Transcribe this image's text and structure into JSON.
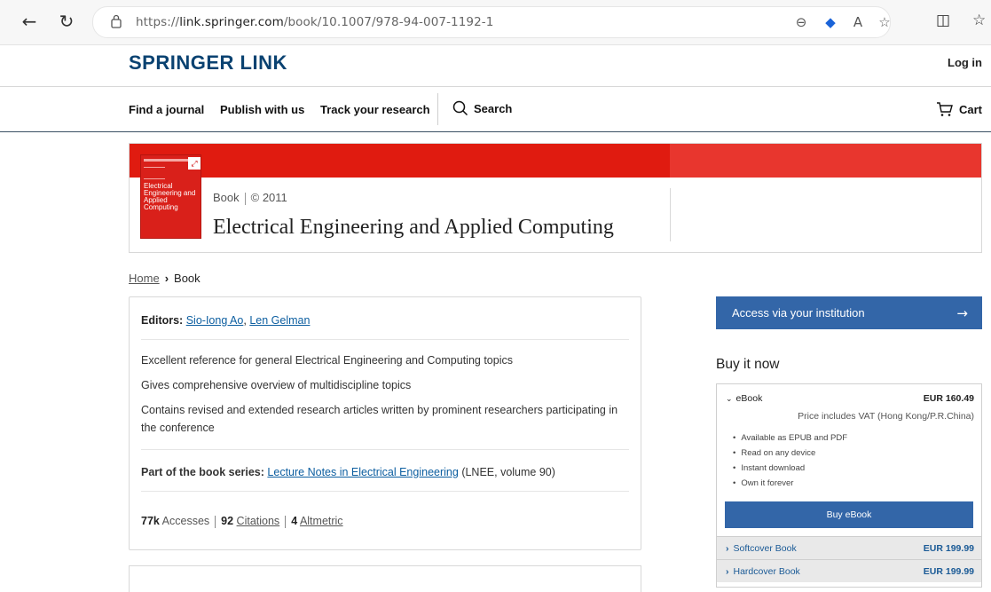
{
  "browser": {
    "url_prefix": "https://",
    "url_host": "link.springer.com",
    "url_path": "/book/10.1007/978-94-007-1192-1"
  },
  "header": {
    "brand": "SPRINGER LINK",
    "login": "Log in",
    "nav": [
      "Find a journal",
      "Publish with us",
      "Track your research"
    ],
    "search": "Search",
    "cart": "Cart"
  },
  "hero": {
    "type": "Book",
    "year": "© 2011",
    "title": "Electrical Engineering and Applied Computing",
    "cover_title": "Electrical Engineering and Applied Computing"
  },
  "breadcrumb": {
    "home": "Home",
    "current": "Book"
  },
  "details": {
    "editors_label": "Editors:",
    "editor1": "Sio-Iong Ao",
    "editor2": "Len Gelman",
    "points": [
      "Excellent reference for general Electrical Engineering and Computing topics",
      "Gives comprehensive overview of multidiscipline topics",
      "Contains revised and extended research articles written by prominent researchers participating in the conference"
    ],
    "series_label": "Part of the book series:",
    "series_name": "Lecture Notes in Electrical Engineering",
    "series_suffix": "(LNEE, volume 90)",
    "accesses_count": "77k",
    "accesses_label": "Accesses",
    "citations_count": "92",
    "citations_label": "Citations",
    "altmetric_count": "4",
    "altmetric_label": "Altmetric"
  },
  "sidebar": {
    "access": "Access via your institution",
    "buy_title": "Buy it now",
    "ebook_label": "eBook",
    "ebook_price": "EUR 160.49",
    "vat": "Price includes VAT (Hong Kong/P.R.China)",
    "features": [
      "Available as EPUB and PDF",
      "Read on any device",
      "Instant download",
      "Own it forever"
    ],
    "buy_button": "Buy eBook",
    "softcover_label": "Softcover Book",
    "softcover_price": "EUR 199.99",
    "hardcover_label": "Hardcover Book",
    "hardcover_price": "EUR 199.99"
  },
  "colors": {
    "brand": "#0a4271",
    "hero_red": "#e01b10",
    "button_blue": "#3366a8",
    "link": "#0c5ea0"
  }
}
